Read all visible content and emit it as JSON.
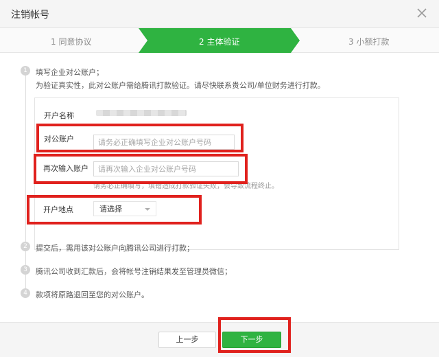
{
  "dialog": {
    "title": "注销帐号"
  },
  "steps": [
    {
      "label": "1 同意协议",
      "active": false
    },
    {
      "label": "2 主体验证",
      "active": true
    },
    {
      "label": "3 小额打款",
      "active": false
    }
  ],
  "accent_color": "#2fb341",
  "highlight_color": "#e0211d",
  "process": {
    "step1": {
      "number": "1",
      "text": "填写企业对公账户；",
      "sub": "为验证真实性，此对公账户需给腾讯打款验证。请尽快联系贵公司/单位财务进行打款。"
    },
    "step2": {
      "number": "2",
      "text": "提交后，需用该对公账户向腾讯公司进行打款；"
    },
    "step3": {
      "number": "3",
      "text": "腾讯公司收到汇款后，会将帐号注销结果发至管理员微信；"
    },
    "step4": {
      "number": "4",
      "text": "款项将原路退回至您的对公账户。"
    }
  },
  "form": {
    "account_name_label": "开户名称",
    "account_label": "对公账户",
    "account_placeholder": "请务必正确填写企业对公账户号码",
    "confirm_label": "再次输入账户",
    "confirm_placeholder": "请再次输入企业对公账户号码",
    "hint": "请务必正确填写，填错造成打款验证失败，会导致流程终止。",
    "location_label": "开户地点",
    "location_value": "请选择"
  },
  "footer": {
    "prev_label": "上一步",
    "next_label": "下一步"
  }
}
